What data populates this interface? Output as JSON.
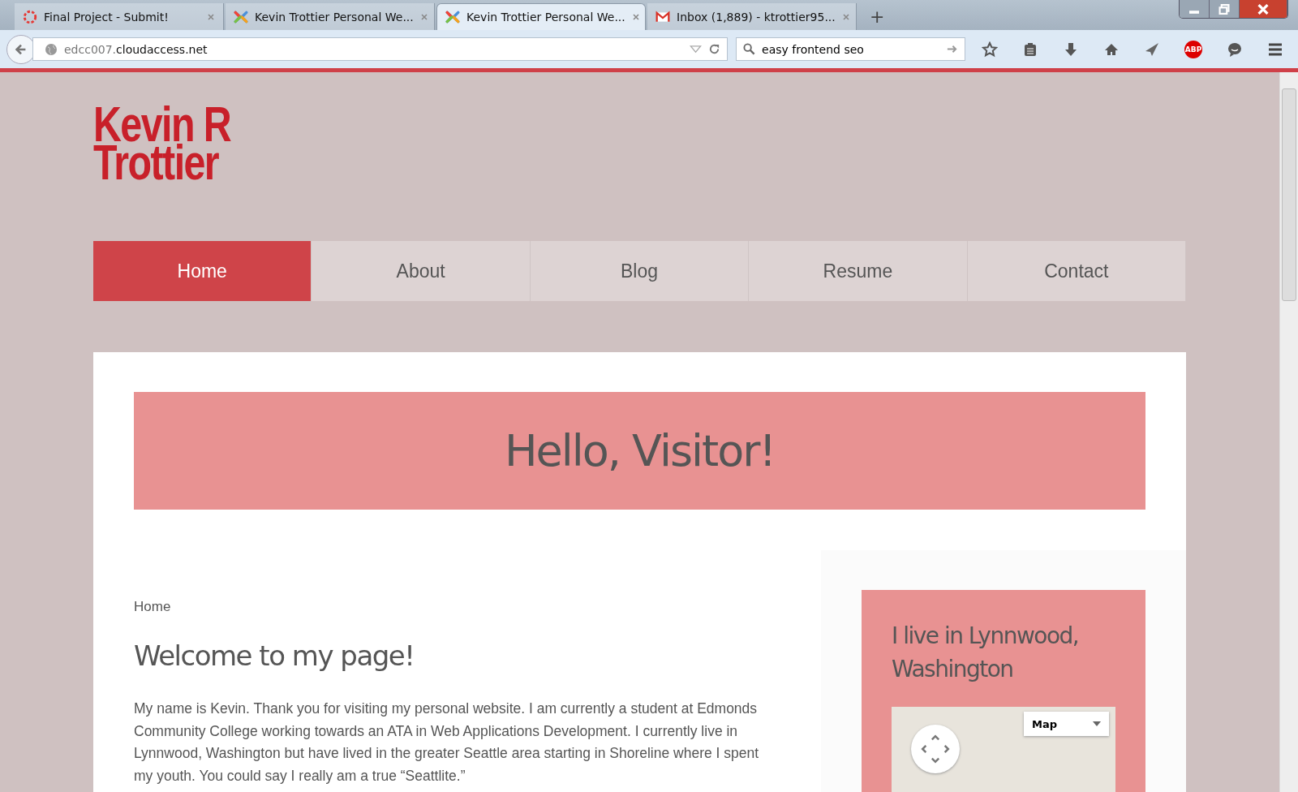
{
  "browser": {
    "tabs": [
      {
        "title": "Final Project - Submit!",
        "selected": false
      },
      {
        "title": "Kevin Trottier Personal We...",
        "selected": false
      },
      {
        "title": "Kevin Trottier Personal We...",
        "selected": true
      },
      {
        "title": "Inbox (1,889) - ktrottier95...",
        "selected": false
      }
    ],
    "new_tab": "+",
    "url_prefix": "edcc007.",
    "url_domain": "cloudaccess.net",
    "search": "easy frontend seo",
    "adblock": "ABP"
  },
  "site": {
    "logo": [
      "Kevin R",
      "Trottier"
    ],
    "nav": [
      {
        "label": "Home",
        "selected": true
      },
      {
        "label": "About",
        "selected": false
      },
      {
        "label": "Blog",
        "selected": false
      },
      {
        "label": "Resume",
        "selected": false
      },
      {
        "label": "Contact",
        "selected": false
      }
    ],
    "banner": "Hello, Visitor!",
    "breadcrumb": "Home",
    "heading": "Welcome to my page!",
    "paragraph": "My name is Kevin. Thank you for visiting my personal website.  I am currently a student at Edmonds Community College working towards an ATA in Web Applications Development.  I currently live in Lynnwood, Washington but have lived in the greater Seattle area starting in Shoreline where I spent my youth.  You could say I really am a true “Seattlite.”",
    "sidebar": {
      "title": "I live in Lynnwood, Washington",
      "map_type": "Map"
    }
  }
}
